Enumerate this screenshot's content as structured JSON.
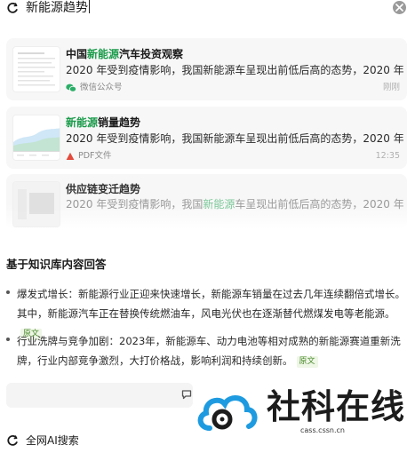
{
  "search": {
    "query": "新能源趋势"
  },
  "results": [
    {
      "title_pre": "中国",
      "title_hl": "新能源",
      "title_post": "汽车投资观察",
      "snippet": "2020 年受到疫情影响，我国新能源车呈现出前低后高的态势，2020 年上…",
      "source_icon": "wechat-icon",
      "source": "微信公众号",
      "time": "刚刚"
    },
    {
      "title_pre": "",
      "title_hl": "新能源",
      "title_post": "销量趋势",
      "snippet": "2020 年受到疫情影响，我国新能源车呈现出前低后高的态势，2020 年上…",
      "source_icon": "pdf-icon",
      "source": "PDF文件",
      "time": "12:35"
    },
    {
      "title_pre": "",
      "title_hl": "",
      "title_post": "供应链变迁趋势",
      "snippet_pre": "2020 年受到疫情影响，我国",
      "snippet_hl": "新能源",
      "snippet_post": "车呈现出前低后高的态势，2020 年上…"
    }
  ],
  "answer": {
    "section_title": "基于知识库内容回答",
    "items": [
      {
        "text": "爆发式增长：新能源行业正迎来快速增长，新能源车销量在过去几年连续翻倍式增长。其中，新能源汽车正在替换传统燃油车，风电光伏也在逐渐替代燃煤发电等老能源。",
        "tag": "原文"
      },
      {
        "text": "行业洗牌与竞争加剧：2023年，新能源车、动力电池等相对成熟的新能源赛道重新洗牌，行业内部竞争激烈，大打价格战，影响利润和持续创新。",
        "tag": "原文"
      }
    ]
  },
  "watermark": {
    "name": "社科在线",
    "url": "cass.cssn.cn"
  },
  "bottom": {
    "label": "全网AI搜索"
  },
  "colors": {
    "highlight": "#1a9b4a",
    "tag_bg": "#eef6e6",
    "tag_fg": "#4b8a2d",
    "watermark_blue": "#1e9be0"
  }
}
